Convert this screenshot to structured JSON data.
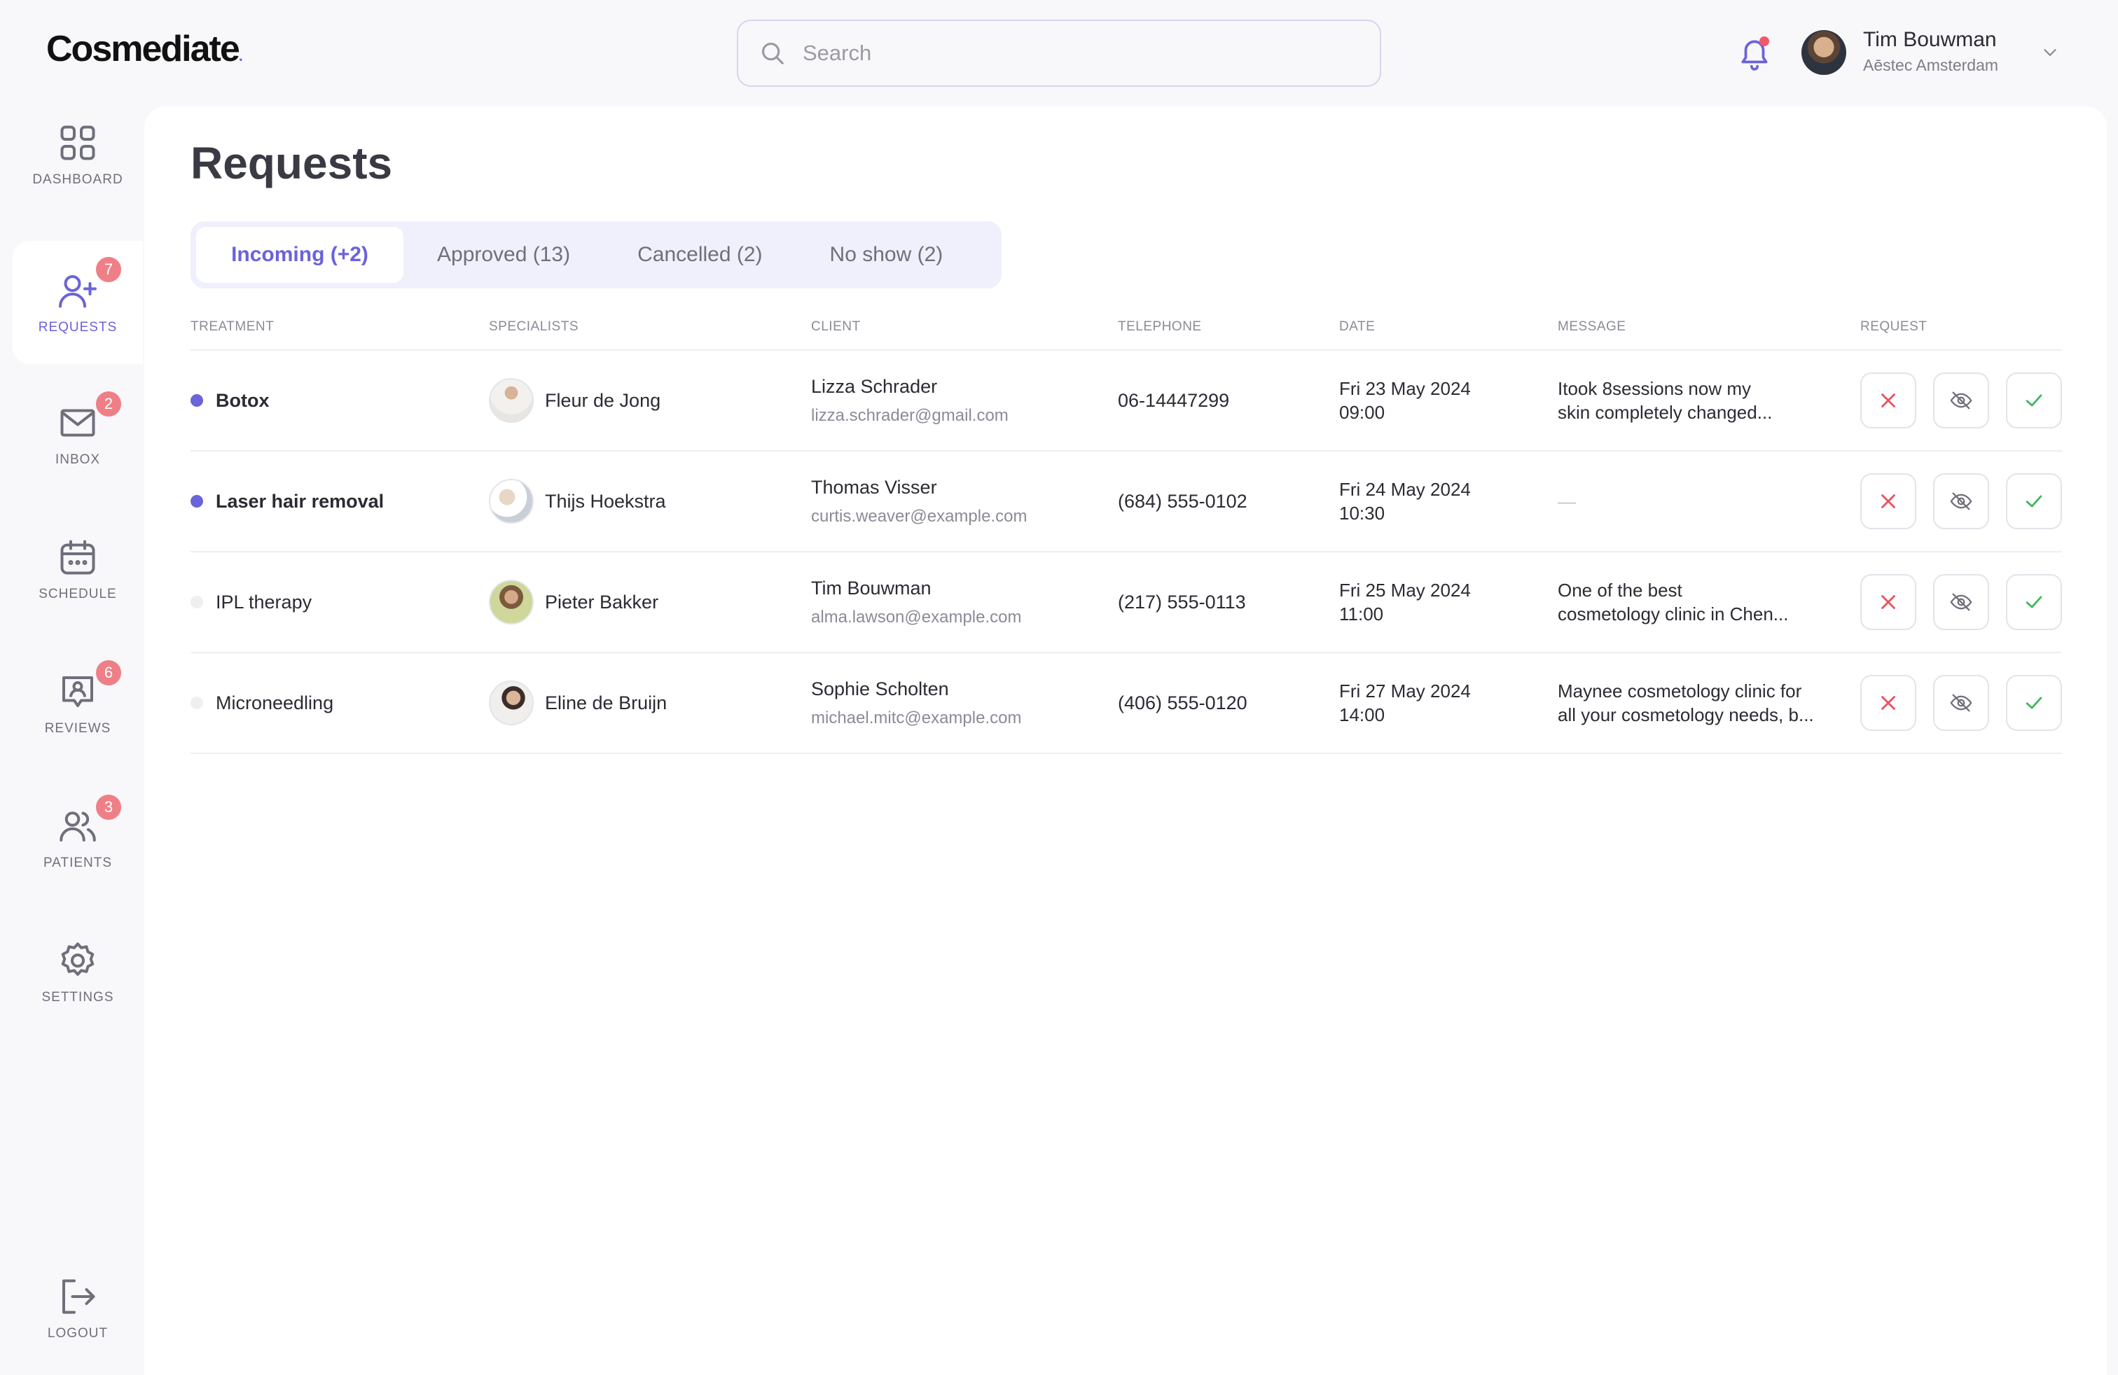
{
  "app": {
    "logo": "Cosmediate"
  },
  "search": {
    "placeholder": "Search"
  },
  "user": {
    "name": "Tim Bouwman",
    "org": "Aēstec Amsterdam"
  },
  "sidebar": {
    "items": [
      {
        "label": "DASHBOARD",
        "icon": "grid-icon",
        "badge": null
      },
      {
        "label": "REQUESTS",
        "icon": "user-add-icon",
        "badge": "7",
        "active": true
      },
      {
        "label": "INBOX",
        "icon": "mail-icon",
        "badge": "2"
      },
      {
        "label": "SCHEDULE",
        "icon": "calendar-icon",
        "badge": null
      },
      {
        "label": "REVIEWS",
        "icon": "review-icon",
        "badge": "6"
      },
      {
        "label": "PATIENTS",
        "icon": "users-icon",
        "badge": "3"
      },
      {
        "label": "SETTINGS",
        "icon": "gear-icon",
        "badge": null
      },
      {
        "label": "LOGOUT",
        "icon": "logout-icon",
        "badge": null
      }
    ]
  },
  "page": {
    "title": "Requests"
  },
  "tabs": [
    {
      "label": "Incoming (+2)",
      "active": true
    },
    {
      "label": "Approved (13)"
    },
    {
      "label": "Cancelled (2)"
    },
    {
      "label": "No show (2)"
    }
  ],
  "table": {
    "headers": [
      "TREATMENT",
      "SPECIALISTS",
      "CLIENT",
      "TELEPHONE",
      "DATE",
      "MESSAGE",
      "REQUEST"
    ],
    "rows": [
      {
        "treatment": "Botox",
        "unread": true,
        "specialist": "Fleur de Jong",
        "client_name": "Lizza Schrader",
        "client_email": "lizza.schrader@gmail.com",
        "telephone": "06-14447299",
        "date_day": "Fri 23 May 2024",
        "date_time": "09:00",
        "message_line1": "Itook 8sessions now my",
        "message_line2": "skin completely changed..."
      },
      {
        "treatment": "Laser hair removal",
        "unread": true,
        "specialist": "Thijs Hoekstra",
        "client_name": "Thomas Visser",
        "client_email": "curtis.weaver@example.com",
        "telephone": "(684) 555-0102",
        "date_day": "Fri 24 May 2024",
        "date_time": "10:30",
        "message_line1": "—",
        "message_line2": ""
      },
      {
        "treatment": "IPL therapy",
        "unread": false,
        "specialist": "Pieter Bakker",
        "client_name": "Tim Bouwman",
        "client_email": "alma.lawson@example.com",
        "telephone": "(217) 555-0113",
        "date_day": "Fri 25 May 2024",
        "date_time": "11:00",
        "message_line1": "One of the best",
        "message_line2": "cosmetology clinic in Chen..."
      },
      {
        "treatment": "Microneedling",
        "unread": false,
        "specialist": "Eline de Bruijn",
        "client_name": "Sophie Scholten",
        "client_email": "michael.mitc@example.com",
        "telephone": "(406) 555-0120",
        "date_day": "Fri 27 May 2024",
        "date_time": "14:00",
        "message_line1": "Maynee cosmetology clinic for",
        "message_line2": "all your cosmetology needs, b..."
      }
    ]
  },
  "colors": {
    "accent": "#6b63d9",
    "badge": "#ef7f86",
    "reject": "#e8545e",
    "approve": "#3fb85f"
  }
}
